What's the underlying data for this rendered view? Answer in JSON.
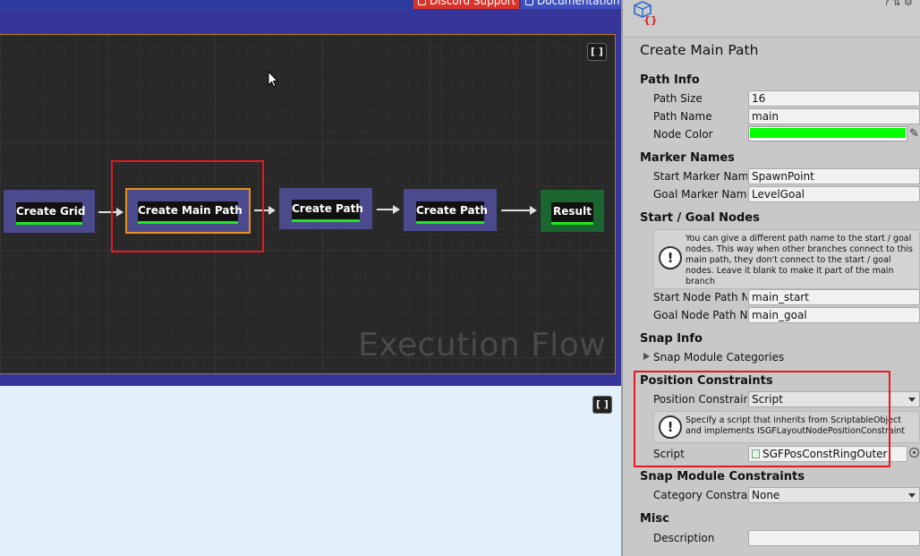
{
  "toolbar": {
    "discord_label": "Discord Support",
    "docs_label": "Documentation"
  },
  "graph": {
    "watermark": "Execution Flow",
    "frame_button_glyph": "[ ]",
    "nodes": [
      {
        "label": "Create Grid"
      },
      {
        "label": "Create Main Path"
      },
      {
        "label": "Create Path"
      },
      {
        "label": "Create Path"
      },
      {
        "label": "Result"
      }
    ]
  },
  "inspector": {
    "title": "Create Main Path",
    "header_icons": "? ⇅ ⚙",
    "path_info": {
      "header": "Path Info",
      "path_size_label": "Path Size",
      "path_size_value": "16",
      "path_name_label": "Path Name",
      "path_name_value": "main",
      "node_color_label": "Node Color",
      "node_color_value": "#00ff00"
    },
    "marker_names": {
      "header": "Marker Names",
      "start_label": "Start Marker Name",
      "start_value": "SpawnPoint",
      "goal_label": "Goal Marker Name",
      "goal_value": "LevelGoal"
    },
    "start_goal_nodes": {
      "header": "Start / Goal Nodes",
      "help_text": "You can give a different path name to the start / goal nodes. This way when other branches connect to this main path, they don't connect to the start / goal nodes. Leave it blank to make it part of the main branch",
      "start_label": "Start Node Path Name",
      "start_value": "main_start",
      "goal_label": "Goal Node Path Name",
      "goal_value": "main_goal"
    },
    "snap_info": {
      "header": "Snap Info",
      "categories_label": "Snap Module Categories"
    },
    "position_constraints": {
      "header": "Position Constraints",
      "mode_label": "Position Constraint Mode",
      "mode_value": "Script",
      "help_text": "Specify a script that inherits from ScriptableObject and implements ISGFLayoutNodePositionConstraint",
      "script_label": "Script",
      "script_value": "SGFPosConstRingOuter"
    },
    "snap_module_constraints": {
      "header": "Snap Module Constraints",
      "category_label": "Category Constraints",
      "category_value": "None"
    },
    "misc": {
      "header": "Misc",
      "description_label": "Description",
      "description_value": ""
    }
  },
  "colors": {
    "graph_background": "#282828",
    "node_fill": "#4a4a8c",
    "result_node_fill": "#1b6530",
    "node_underline": "#1ee61e",
    "selected_node_border": "#e89020",
    "highlight_box": "#e8181e"
  }
}
